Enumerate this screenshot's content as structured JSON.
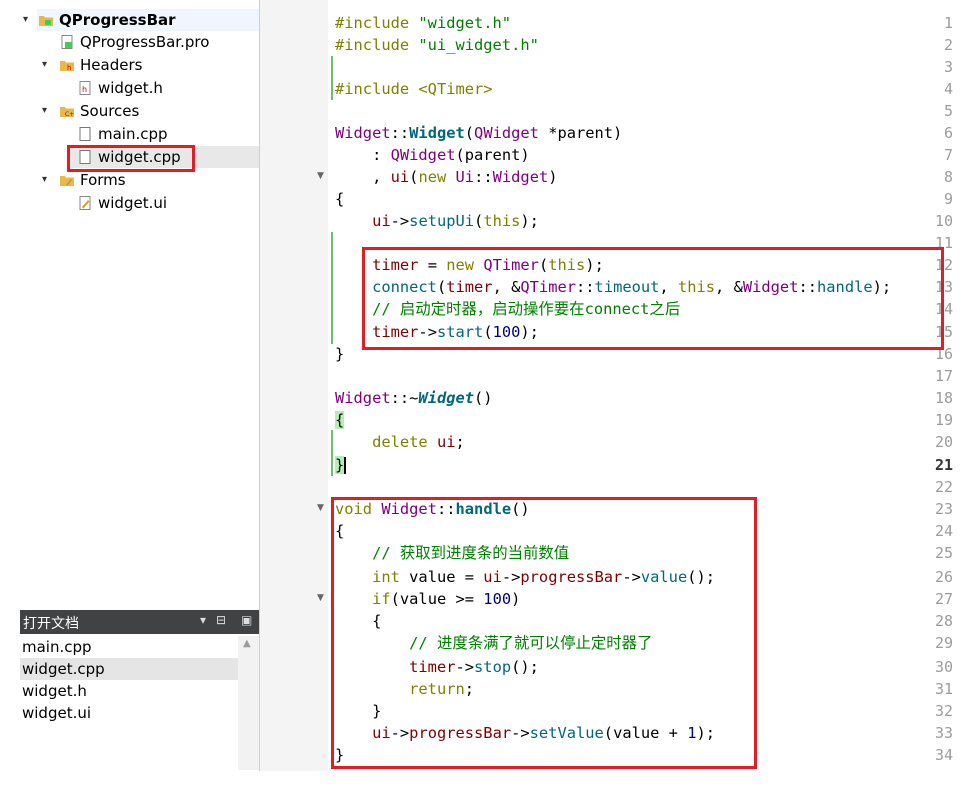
{
  "project_tree": {
    "items": [
      {
        "label": "QProgressBar",
        "icon": "project-folder-icon",
        "bold": true,
        "level": 0,
        "expanded": true
      },
      {
        "label": "QProgressBar.pro",
        "icon": "pro-file-icon",
        "level": 1
      },
      {
        "label": "Headers",
        "icon": "headers-folder-icon",
        "level": 1,
        "expanded": true
      },
      {
        "label": "widget.h",
        "icon": "header-file-icon",
        "level": 2
      },
      {
        "label": "Sources",
        "icon": "sources-folder-icon",
        "level": 1,
        "expanded": true
      },
      {
        "label": "main.cpp",
        "icon": "cpp-file-icon",
        "level": 2
      },
      {
        "label": "widget.cpp",
        "icon": "cpp-file-icon",
        "level": 2,
        "selected": true
      },
      {
        "label": "Forms",
        "icon": "forms-folder-icon",
        "level": 1,
        "expanded": true
      },
      {
        "label": "widget.ui",
        "icon": "ui-file-icon",
        "level": 2
      }
    ]
  },
  "open_documents": {
    "title": "打开文档",
    "controls": [
      "dropdown-icon",
      "split-icon",
      "close-pane-icon"
    ],
    "items": [
      {
        "label": "main.cpp"
      },
      {
        "label": "widget.cpp",
        "selected": true
      },
      {
        "label": "widget.h"
      },
      {
        "label": "widget.ui"
      }
    ]
  },
  "editor": {
    "current_line": 21,
    "line_numbers": [
      "1",
      "2",
      "3",
      "4",
      "5",
      "6",
      "7",
      "8",
      "9",
      "10",
      "11",
      "12",
      "13",
      "14",
      "15",
      "16",
      "17",
      "18",
      "19",
      "20",
      "21",
      "22",
      "23",
      "24",
      "25",
      "26",
      "27",
      "28",
      "29",
      "30",
      "31",
      "32",
      "33",
      "34"
    ],
    "lines": {
      "l1_kw": "#include",
      "l1_str": " \"widget.h\"",
      "l2_kw": "#include",
      "l2_str": " \"ui_widget.h\"",
      "l4_kw": "#include",
      "l4_str": " <QTimer>",
      "l6_a": "Widget",
      "l6_b": "::",
      "l6_c": "Widget",
      "l6_d": "(",
      "l6_e": "QWidget",
      "l6_f": " *parent)",
      "l7_a": "    : ",
      "l7_b": "QWidget",
      "l7_c": "(parent)",
      "l8_a": "    , ",
      "l8_b": "ui",
      "l8_c": "(",
      "l8_d": "new",
      "l8_e": " ",
      "l8_f": "Ui",
      "l8_g": "::",
      "l8_h": "Widget",
      "l8_i": ")",
      "l9": "{",
      "l10_a": "    ",
      "l10_b": "ui",
      "l10_c": "->",
      "l10_d": "setupUi",
      "l10_e": "(",
      "l10_f": "this",
      "l10_g": ");",
      "l12_a": "    ",
      "l12_b": "timer",
      "l12_c": " = ",
      "l12_d": "new",
      "l12_e": " ",
      "l12_f": "QTimer",
      "l12_g": "(",
      "l12_h": "this",
      "l12_i": ");",
      "l13_a": "    ",
      "l13_b": "connect",
      "l13_c": "(",
      "l13_d": "timer",
      "l13_e": ", &",
      "l13_f": "QTimer",
      "l13_g": "::",
      "l13_h": "timeout",
      "l13_i": ", ",
      "l13_j": "this",
      "l13_k": ", &",
      "l13_l": "Widget",
      "l13_m": "::",
      "l13_n": "handle",
      "l13_o": ");",
      "l14_a": "    ",
      "l14_b": "// 启动定时器，启动操作要在connect之后",
      "l15_a": "    ",
      "l15_b": "timer",
      "l15_c": "->",
      "l15_d": "start",
      "l15_e": "(",
      "l15_f": "100",
      "l15_g": ");",
      "l16": "}",
      "l18_a": "Widget",
      "l18_b": "::~",
      "l18_c": "Widget",
      "l18_d": "()",
      "l19": "{",
      "l20_a": "    ",
      "l20_b": "delete",
      "l20_c": " ",
      "l20_d": "ui",
      "l20_e": ";",
      "l21": "}",
      "l23_a": "void",
      "l23_b": " ",
      "l23_c": "Widget",
      "l23_d": "::",
      "l23_e": "handle",
      "l23_f": "()",
      "l24": "{",
      "l25_a": "    ",
      "l25_b": "// 获取到进度条的当前数值",
      "l26_a": "    ",
      "l26_b": "int",
      "l26_c": " value = ",
      "l26_d": "ui",
      "l26_e": "->",
      "l26_f": "progressBar",
      "l26_g": "->",
      "l26_h": "value",
      "l26_i": "();",
      "l27_a": "    ",
      "l27_b": "if",
      "l27_c": "(value >= ",
      "l27_d": "100",
      "l27_e": ")",
      "l28": "    {",
      "l29_a": "        ",
      "l29_b": "// 进度条满了就可以停止定时器了",
      "l30_a": "        ",
      "l30_b": "timer",
      "l30_c": "->",
      "l30_d": "stop",
      "l30_e": "();",
      "l31_a": "        ",
      "l31_b": "return",
      "l31_c": ";",
      "l32": "    }",
      "l33_a": "    ",
      "l33_b": "ui",
      "l33_c": "->",
      "l33_d": "progressBar",
      "l33_e": "->",
      "l33_f": "setValue",
      "l33_g": "(value + ",
      "l33_h": "1",
      "l33_i": ");",
      "l34": "}"
    }
  },
  "colors": {
    "annotation_red": "#e01e24",
    "keyword": "#808000",
    "string": "#008000",
    "class": "#800080",
    "function": "#00677c",
    "member": "#800000",
    "number": "#000080",
    "change_marker": "#6ec06e"
  }
}
